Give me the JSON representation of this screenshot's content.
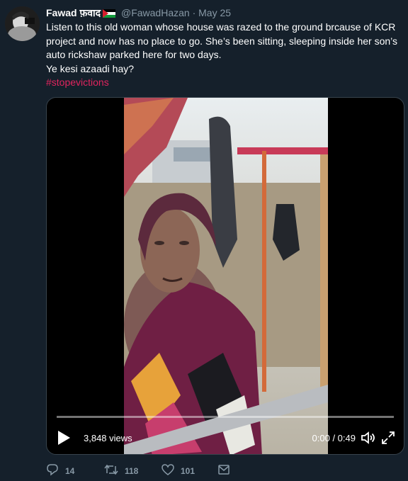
{
  "tweet": {
    "author": {
      "name": "Fawad फ़वाद",
      "handle": "@FawadHazan",
      "separator": "·",
      "date": "May 25"
    },
    "text_lines": [
      "Listen to this old woman whose house was razed to the ground brcause of KCR project and now has no place to go. She’s been sitting, sleeping inside her son’s auto rickshaw parked here for two days.",
      "Ye kesi azaadi hay?"
    ],
    "hashtag": "#stopevictions"
  },
  "video": {
    "views": "3,848 views",
    "time": "0:00 / 0:49",
    "progress": 0.0
  },
  "actions": {
    "replies": "14",
    "retweets": "118",
    "likes": "101"
  },
  "colors": {
    "background": "#15202b",
    "muted": "#8899a6",
    "hashtag": "#e0245e"
  }
}
